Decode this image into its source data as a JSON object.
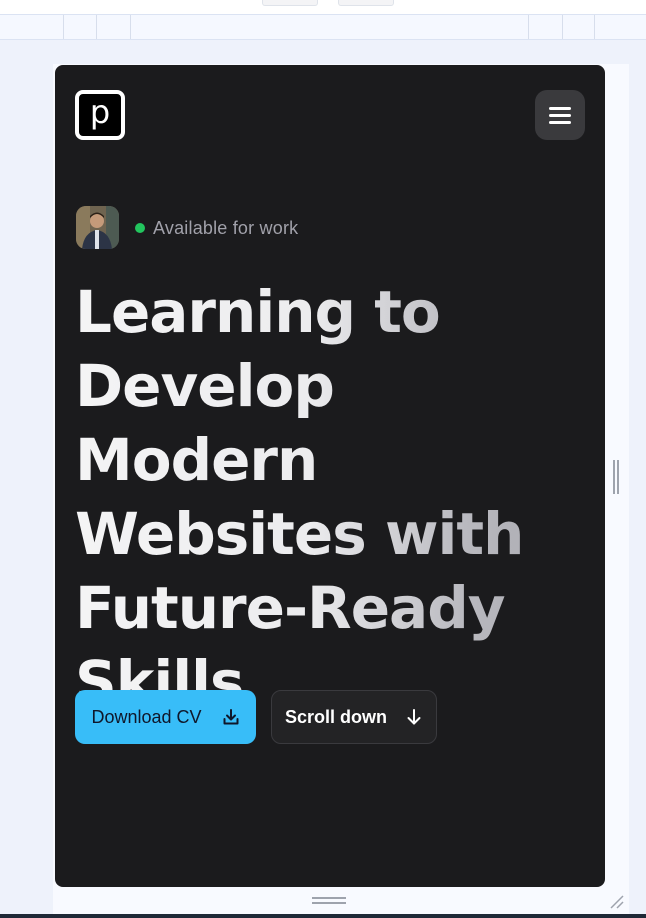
{
  "site": {
    "logo_letter": "p"
  },
  "status": {
    "label": "Available for work",
    "color": "#22c55e"
  },
  "hero": {
    "lines": [
      "Learning to",
      "Develop Modern",
      "Websites with",
      "Future-Ready",
      "Skills"
    ]
  },
  "actions": {
    "download_label": "Download CV",
    "download_icon": "download-icon",
    "scroll_label": "Scroll down",
    "scroll_icon": "arrow-down-icon"
  },
  "colors": {
    "accent": "#38bdf8",
    "background": "#1b1b1d",
    "status_dot": "#22c55e"
  }
}
